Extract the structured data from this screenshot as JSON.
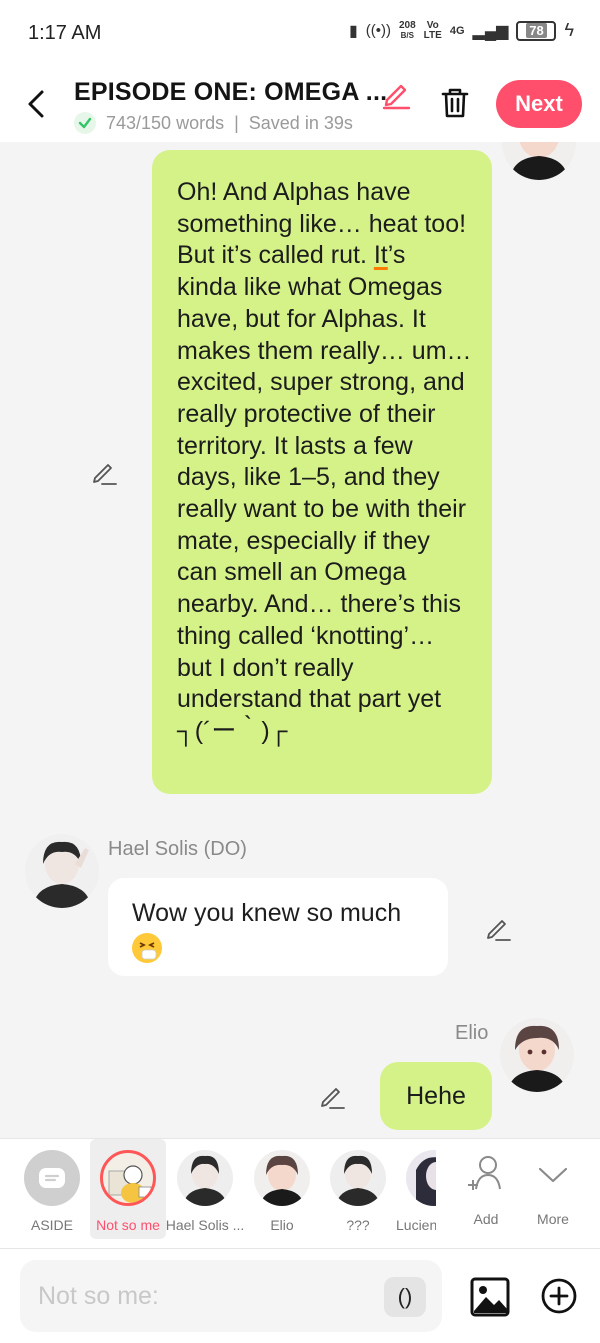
{
  "status": {
    "time": "1:17 AM",
    "net_speed": "208",
    "net_unit": "B/S",
    "volte_top": "Vo",
    "volte_bottom": "LTE",
    "network": "4G",
    "battery": "78"
  },
  "header": {
    "title": "EPISODE ONE: OMEGA ...",
    "word_count": "743/150 words",
    "saved": "Saved in 39s",
    "next_label": "Next"
  },
  "messages": [
    {
      "text_part1": "Oh! And Alphas have something like… heat too! But it’s called rut. ",
      "text_underlined": "It",
      "text_part2": "’s kinda like what Omegas have, but for Alphas. It makes them really… um… excited, super strong, and really protective of their territory. It lasts a few days, like 1–5, and they really want to be with their mate, especially if they can smell an Omega nearby. And… there’s this thing called ‘knotting’… but I don’t really understand that part yet ┐(´ー｀)┌"
    },
    {
      "sender": "Hael Solis (DO)",
      "text": "Wow you knew so much"
    },
    {
      "sender": "Elio",
      "text": "Hehe"
    }
  ],
  "characters": [
    {
      "label": "ASIDE"
    },
    {
      "label": "Not so me"
    },
    {
      "label": "Hael Solis ..."
    },
    {
      "label": "Elio"
    },
    {
      "label": "???"
    },
    {
      "label": "Lucien"
    },
    {
      "label": "Add"
    },
    {
      "label": "More"
    }
  ],
  "composer": {
    "placeholder": "Not so me:",
    "paren_label": "()"
  },
  "colors": {
    "accent": "#ff4f6d",
    "bubble_green": "#d5f289",
    "bubble_white": "#ffffff",
    "background": "#f4f4f4"
  }
}
